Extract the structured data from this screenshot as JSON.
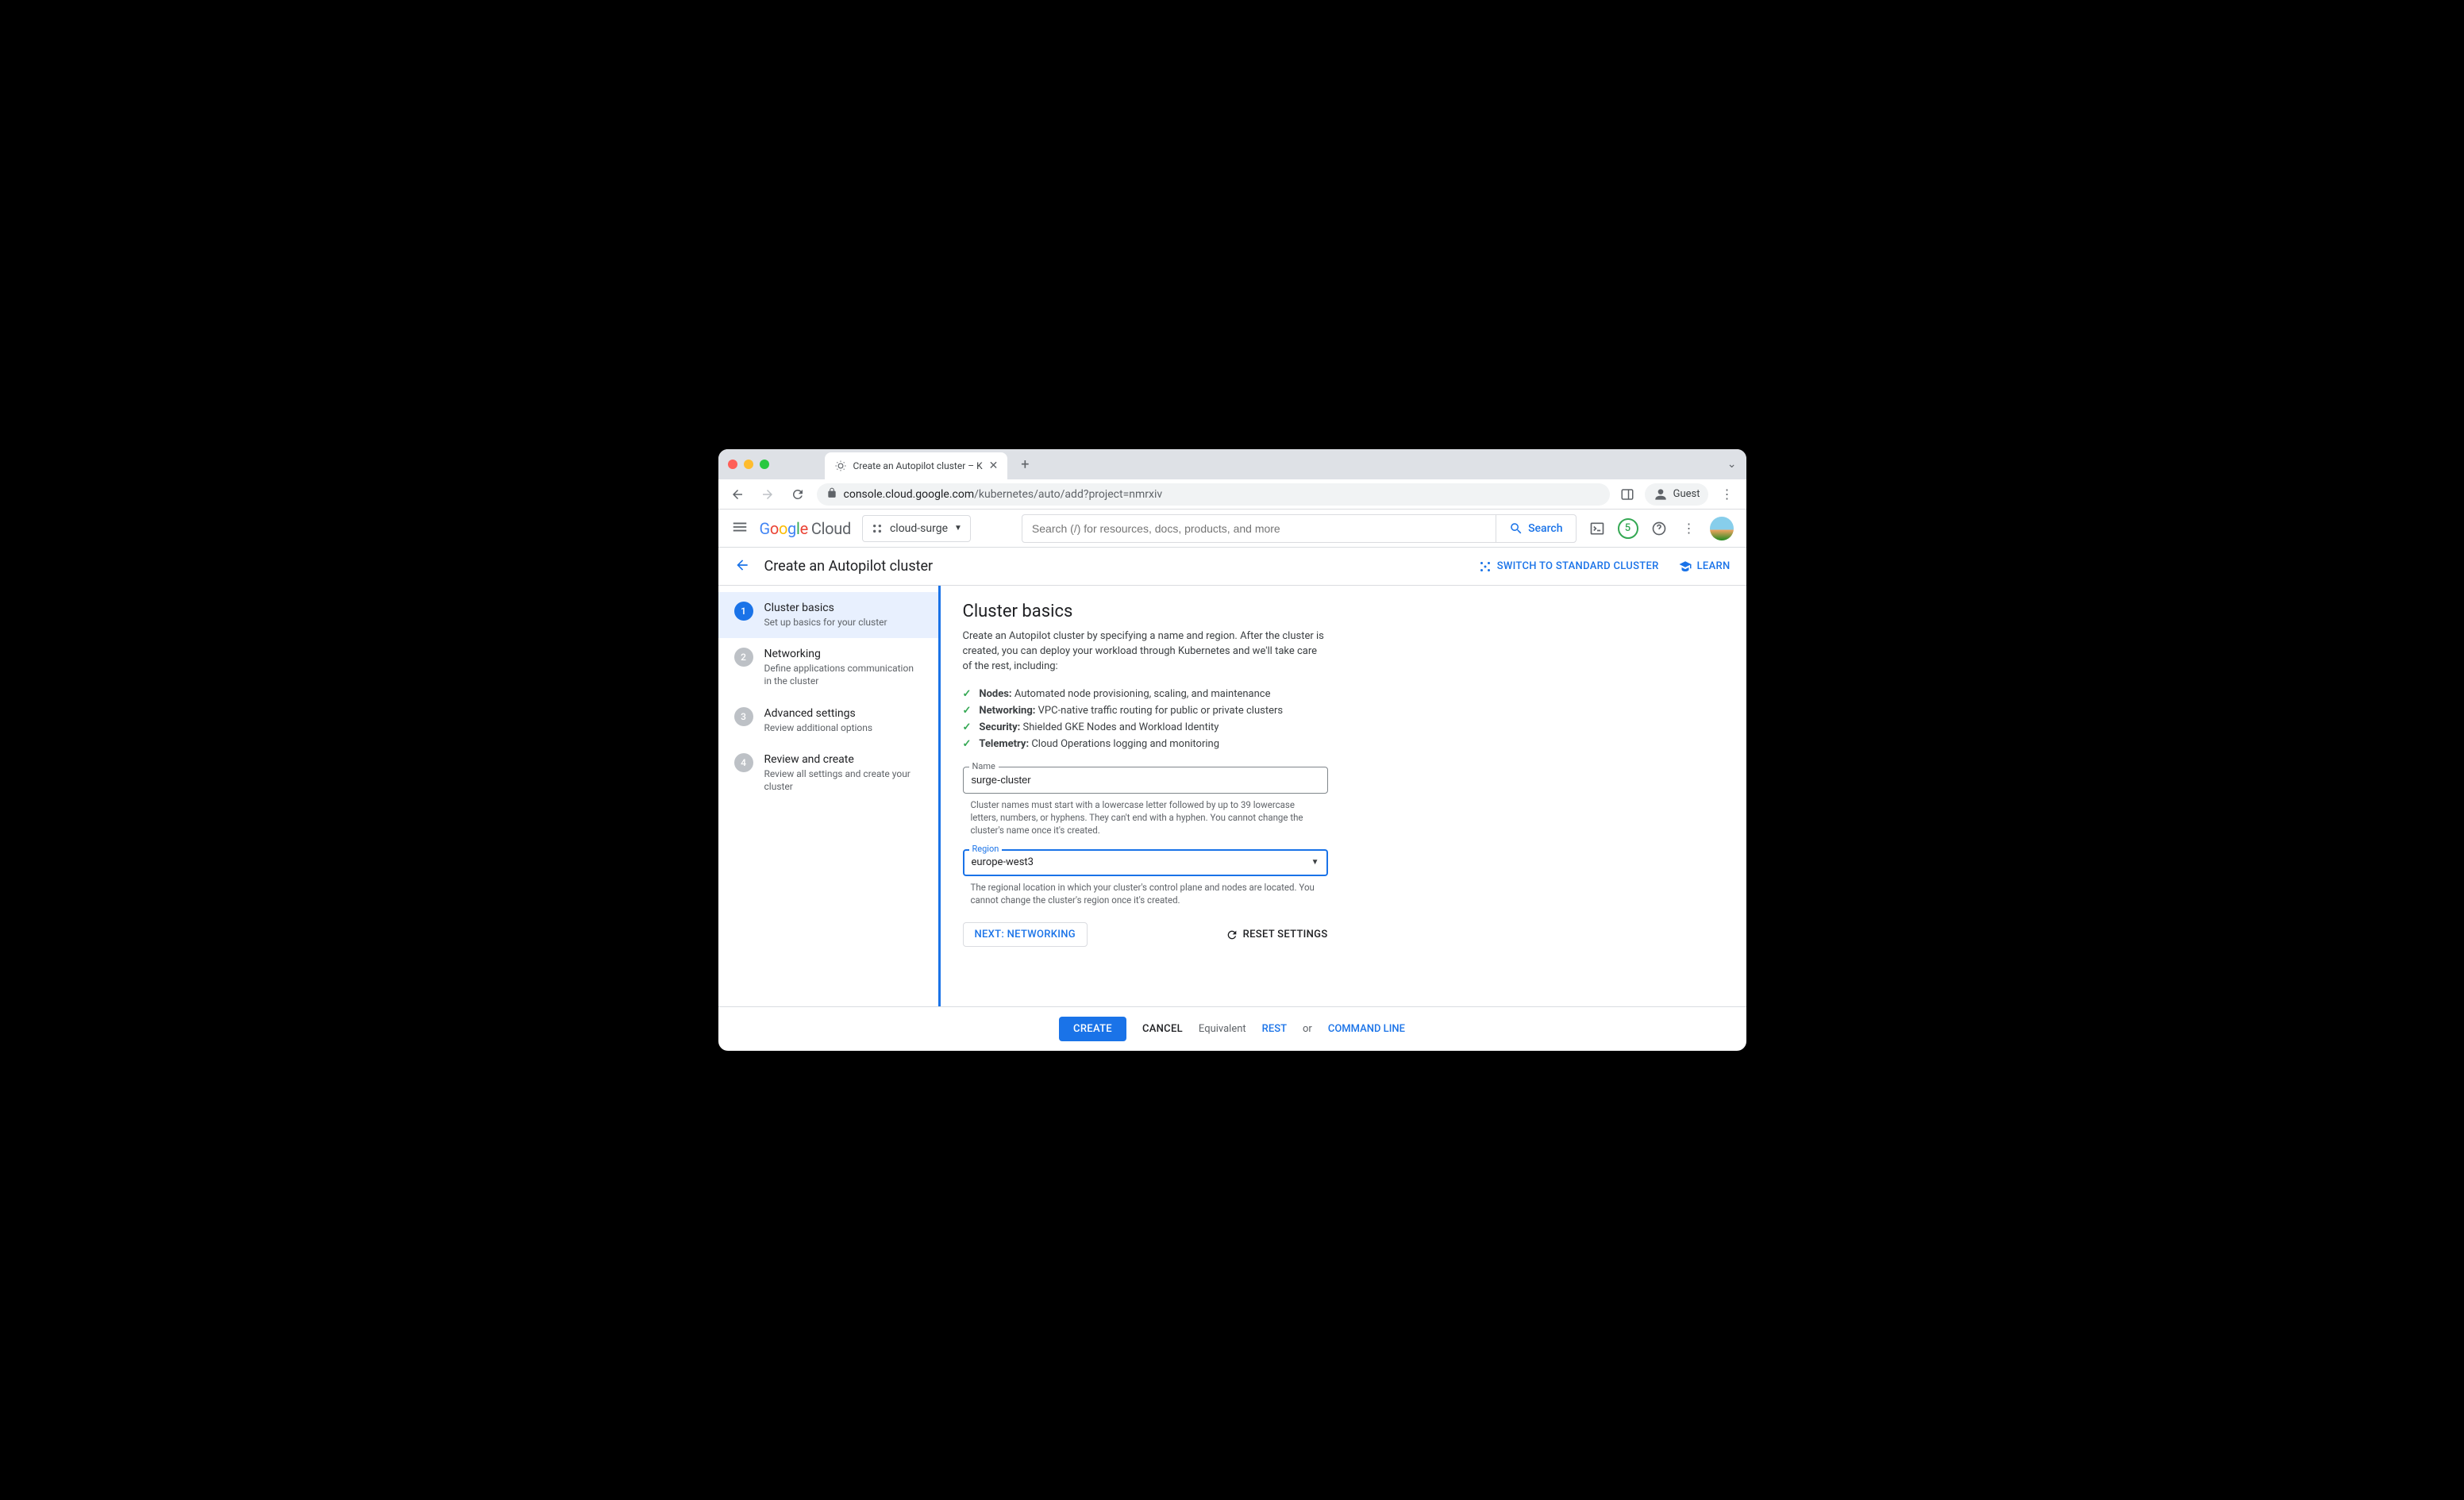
{
  "browser": {
    "tab_title": "Create an Autopilot cluster – K",
    "url_display": "console.cloud.google.com/kubernetes/auto/add?project=nmrxiv",
    "url_host": "console.cloud.google.com",
    "url_path": "/kubernetes/auto/add?project=nmrxiv",
    "profile_label": "Guest"
  },
  "gcp": {
    "logo_text_google": "Google",
    "logo_text_cloud": "Cloud",
    "project_name": "cloud-surge",
    "search_placeholder": "Search (/) for resources, docs, products, and more",
    "search_button": "Search",
    "trial_count": "5"
  },
  "header": {
    "title": "Create an Autopilot cluster",
    "switch_standard": "SWITCH TO STANDARD CLUSTER",
    "learn": "LEARN"
  },
  "stepper": [
    {
      "num": "1",
      "title": "Cluster basics",
      "sub": "Set up basics for your cluster"
    },
    {
      "num": "2",
      "title": "Networking",
      "sub": "Define applications communication in the cluster"
    },
    {
      "num": "3",
      "title": "Advanced settings",
      "sub": "Review additional options"
    },
    {
      "num": "4",
      "title": "Review and create",
      "sub": "Review all settings and create your cluster"
    }
  ],
  "main": {
    "heading": "Cluster basics",
    "description": "Create an Autopilot cluster by specifying a name and region. After the cluster is created, you can deploy your workload through Kubernetes and we'll take care of the rest, including:",
    "features": [
      {
        "strong": "Nodes:",
        "rest": " Automated node provisioning, scaling, and maintenance"
      },
      {
        "strong": "Networking:",
        "rest": " VPC-native traffic routing for public or private clusters"
      },
      {
        "strong": "Security:",
        "rest": " Shielded GKE Nodes and Workload Identity"
      },
      {
        "strong": "Telemetry:",
        "rest": " Cloud Operations logging and monitoring"
      }
    ],
    "name_label": "Name",
    "name_value": "surge-cluster",
    "name_helper": "Cluster names must start with a lowercase letter followed by up to 39 lowercase letters, numbers, or hyphens. They can't end with a hyphen. You cannot change the cluster's name once it's created.",
    "region_label": "Region",
    "region_value": "europe-west3",
    "region_helper": "The regional location in which your cluster's control plane and nodes are located. You cannot change the cluster's region once it's created.",
    "next_button": "NEXT: NETWORKING",
    "reset_button": "RESET SETTINGS"
  },
  "footer": {
    "create": "CREATE",
    "cancel": "CANCEL",
    "equivalent": "Equivalent",
    "rest": "REST",
    "or": "or",
    "cli": "COMMAND LINE"
  }
}
